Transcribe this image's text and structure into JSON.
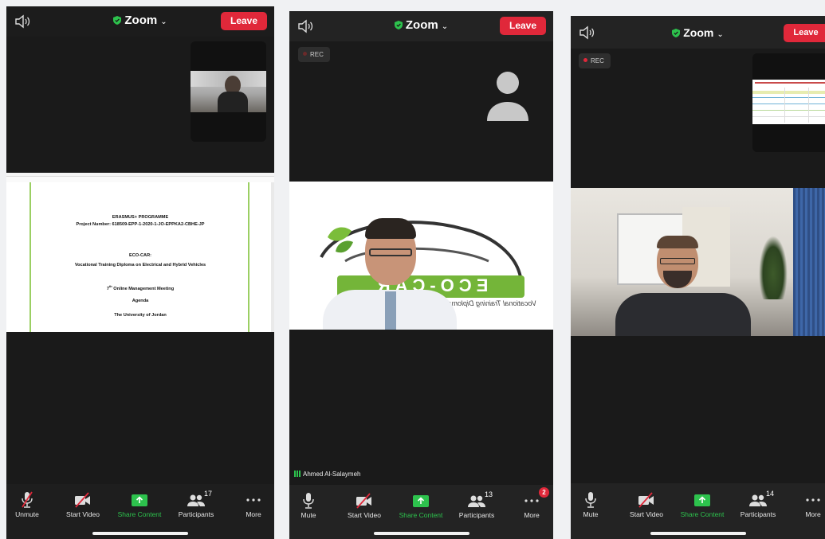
{
  "app": {
    "title": "Zoom",
    "leave_label": "Leave",
    "rec_label": "REC"
  },
  "toolbar_labels": {
    "unmute": "Unmute",
    "mute": "Mute",
    "start_video": "Start Video",
    "share": "Share Content",
    "participants": "Participants",
    "more": "More"
  },
  "phone1": {
    "participant_count": "17"
  },
  "phone2": {
    "participant_count": "13",
    "more_badge": "2",
    "speaker_name": "Ahmed Al-Salaymeh"
  },
  "phone3": {
    "participant_count": "14"
  },
  "agenda": {
    "line1": "ERASMUS+ PROGRAMME",
    "line2": "Project Number: 618509-EPP-1-2020-1-JO-EPPKA2-CBHE-JP",
    "line3": "ECO-CAR:",
    "line4": "Vocational Training Diploma on Electrical and Hybrid Vehicles",
    "line5_num": "7",
    "line5_sup": "th",
    "line5_rest": " Online Management Meeting",
    "line6": "Agenda",
    "line7": "The University of Jordan"
  },
  "logo": {
    "text": "ECO-CAR",
    "tagline": "Vocational Training Diploma"
  },
  "colors": {
    "leave": "#e0283a",
    "share_green": "#2dc24d",
    "zoom_shield": "#2dc24d",
    "background": "#1a1a1a"
  },
  "icons": [
    "speaker-icon",
    "shield-icon",
    "chevron-down-icon",
    "mic-muted-icon",
    "mic-icon",
    "video-off-icon",
    "share-arrow-icon",
    "participants-icon",
    "more-icon",
    "avatar-icon"
  ]
}
